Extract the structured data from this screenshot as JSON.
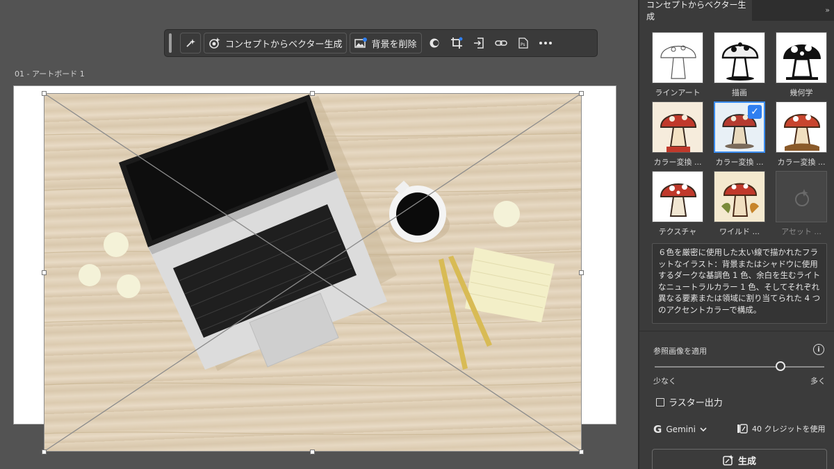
{
  "toolbar": {
    "concept_button_label": "コンセプトからベクター生成",
    "remove_bg_button_label": "背景を削除"
  },
  "canvas": {
    "artboard_label": "01 - アートボード 1"
  },
  "panel": {
    "tab_title": "コンセプトからベクター生成",
    "collapse_glyph": "»",
    "styles": [
      {
        "label": "ラインアート",
        "selected": false,
        "disabled": false
      },
      {
        "label": "描画",
        "selected": false,
        "disabled": false
      },
      {
        "label": "幾何学",
        "selected": false,
        "disabled": false
      },
      {
        "label": "カラー変換 ...",
        "selected": false,
        "disabled": false
      },
      {
        "label": "カラー変換 ...",
        "selected": true,
        "disabled": false
      },
      {
        "label": "カラー変換 ...",
        "selected": false,
        "disabled": false
      },
      {
        "label": "テクスチャ",
        "selected": false,
        "disabled": false
      },
      {
        "label": "ワイルド ...",
        "selected": false,
        "disabled": false
      },
      {
        "label": "アセット ...",
        "selected": false,
        "disabled": true
      }
    ],
    "prompt_text": "６色を厳密に使用した太い線で描かれたフラットなイラスト：背景またはシャドウに使用するダークな基調色 1 色、余白を生むライトなニュートラルカラー 1 色、そしてそれぞれ異なる要素または領域に割り当てられた 4 つのアクセントカラーで構成。",
    "reference": {
      "label": "参照画像を適用",
      "min_label": "少なく",
      "max_label": "多く",
      "value_fraction": 0.74
    },
    "raster_label": "ラスター出力",
    "model_label": "Gemini",
    "credits_label": "40 クレジットを使用",
    "generate_label": "生成"
  },
  "colors": {
    "accent": "#2f7ff0",
    "panel_bg": "#3b3b3b",
    "canvas_bg": "#535353"
  }
}
